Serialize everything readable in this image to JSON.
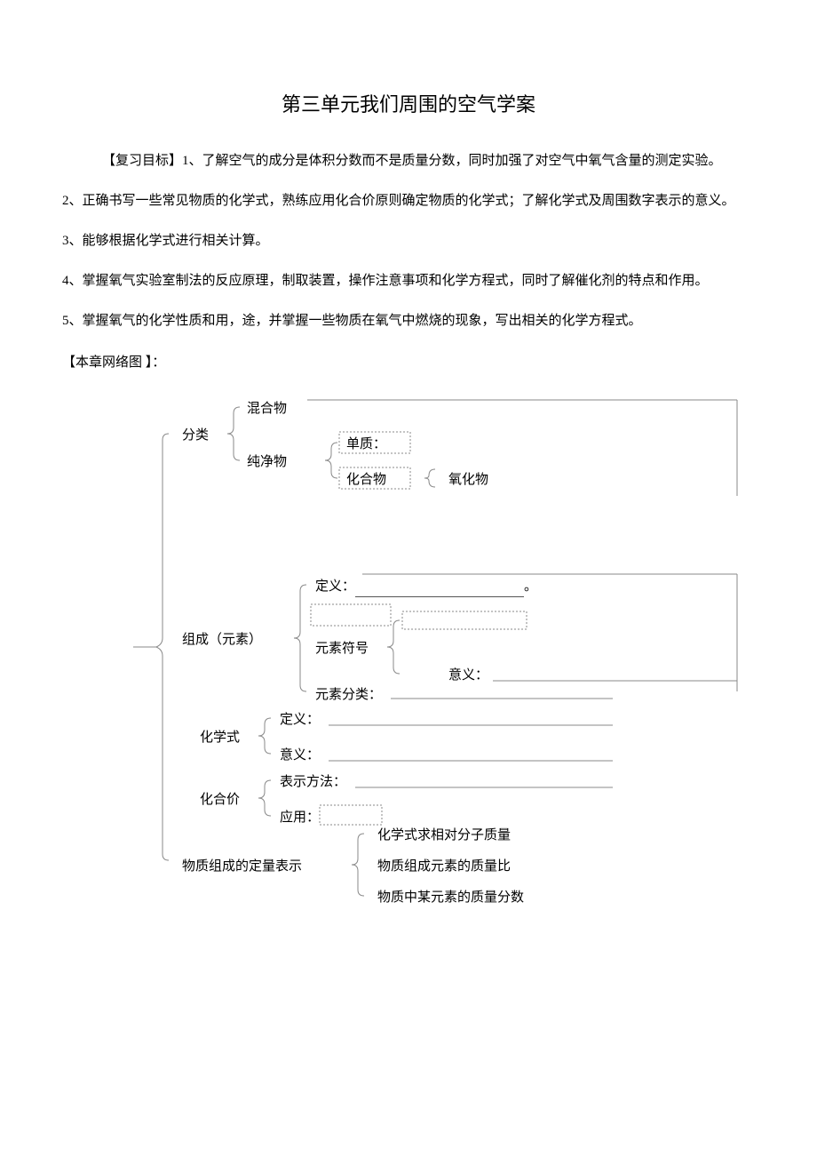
{
  "title": "第三单元我们周围的空气学案",
  "section_objectives_label": "【复习目标】",
  "objectives": {
    "o1": "1、了解空气的成分是体积分数而不是质量分数，同时加强了对空气中氧气含量的测定实验。",
    "o2": "2、正确书写一些常见物质的化学式，熟练应用化合价原则确定物质的化学式；了解化学式及周围数字表示的意义。",
    "o3": "3、能够根据化学式进行相关计算。",
    "o4": "4、掌握氧气实验室制法的反应原理，制取装置，操作注意事项和化学方程式，同时了解催化剂的特点和作用。",
    "o5": "5、掌握氧气的化学性质和用，途，并掌握一些物质在氧气中燃烧的现象，写出相关的化学方程式。"
  },
  "diagram_label": "【本章网络图 】：",
  "diagram": {
    "fenlei": "分类",
    "hunhewu": "混合物",
    "chunjingwu": "纯净物",
    "danzhi": "单质：",
    "huahewu": "化合物",
    "yanghuawu": "氧化物",
    "zucheng": "组成（元素）",
    "dingyi": "定义：",
    "yuansu_fuhao": "元素符号",
    "yiyi": "意义：",
    "yuansu_fenlei": "元素分类：",
    "huaxueshi": "化学式",
    "dingyi2": "定义：",
    "yiyi2": "意义：",
    "huahejia": "化合价",
    "biaoshi": "表示方法：",
    "yingyong": "应用：",
    "dingliang": "物质组成的定量表示",
    "q1": "化学式求相对分子质量",
    "q2": "物质组成元素的质量比",
    "q3": "物质中某元素的质量分数",
    "period": "。"
  }
}
